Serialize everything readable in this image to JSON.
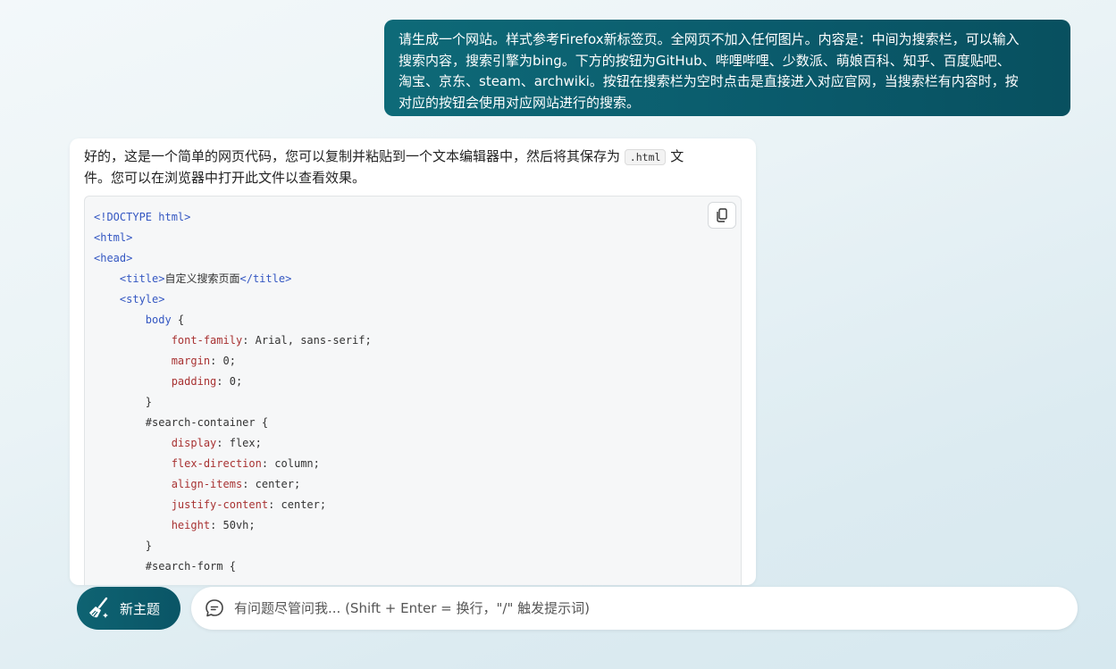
{
  "user_message": {
    "lines": [
      "请生成一个网站。样式参考Firefox新标签页。全网页不加入任何图片。内容是：中间为搜索栏，可以输入",
      "搜索内容，搜索引擎为bing。下方的按钮为GitHub、哔哩哔哩、少数派、萌娘百科、知乎、百度贴吧、",
      "淘宝、京东、steam、archwiki。按钮在搜索栏为空时点击是直接进入对应官网，当搜索栏有内容时，按",
      "对应的按钮会使用对应网站进行的搜索。"
    ]
  },
  "assistant": {
    "intro_part1": "好的，这是一个简单的网页代码，您可以复制并粘贴到一个文本编辑器中，然后将其保存为",
    "intro_code": ".html",
    "intro_part2": "文",
    "intro_line2": "件。您可以在浏览器中打开此文件以查看效果。",
    "code_lines": [
      [
        {
          "t": "<!DOCTYPE html>",
          "c": "tag"
        }
      ],
      [
        {
          "t": "<html>",
          "c": "tag"
        }
      ],
      [
        {
          "t": "<head>",
          "c": "tag"
        }
      ],
      [
        {
          "t": "    ",
          "c": "plain"
        },
        {
          "t": "<title>",
          "c": "tag"
        },
        {
          "t": "自定义搜索页面",
          "c": "plain"
        },
        {
          "t": "</title>",
          "c": "tag"
        }
      ],
      [
        {
          "t": "    ",
          "c": "plain"
        },
        {
          "t": "<style>",
          "c": "tag"
        }
      ],
      [
        {
          "t": "        ",
          "c": "plain"
        },
        {
          "t": "body",
          "c": "tag"
        },
        {
          "t": " {",
          "c": "plain"
        }
      ],
      [
        {
          "t": "            ",
          "c": "plain"
        },
        {
          "t": "font-family",
          "c": "prop"
        },
        {
          "t": ": Arial, sans-serif;",
          "c": "plain"
        }
      ],
      [
        {
          "t": "            ",
          "c": "plain"
        },
        {
          "t": "margin",
          "c": "prop"
        },
        {
          "t": ": 0;",
          "c": "plain"
        }
      ],
      [
        {
          "t": "            ",
          "c": "plain"
        },
        {
          "t": "padding",
          "c": "prop"
        },
        {
          "t": ": 0;",
          "c": "plain"
        }
      ],
      [
        {
          "t": "        }",
          "c": "plain"
        }
      ],
      [
        {
          "t": "        #search-container {",
          "c": "plain"
        }
      ],
      [
        {
          "t": "            ",
          "c": "plain"
        },
        {
          "t": "display",
          "c": "prop"
        },
        {
          "t": ": flex;",
          "c": "plain"
        }
      ],
      [
        {
          "t": "            ",
          "c": "plain"
        },
        {
          "t": "flex-direction",
          "c": "prop"
        },
        {
          "t": ": column;",
          "c": "plain"
        }
      ],
      [
        {
          "t": "            ",
          "c": "plain"
        },
        {
          "t": "align-items",
          "c": "prop"
        },
        {
          "t": ": center;",
          "c": "plain"
        }
      ],
      [
        {
          "t": "            ",
          "c": "plain"
        },
        {
          "t": "justify-content",
          "c": "prop"
        },
        {
          "t": ": center;",
          "c": "plain"
        }
      ],
      [
        {
          "t": "            ",
          "c": "plain"
        },
        {
          "t": "height",
          "c": "prop"
        },
        {
          "t": ": 50vh;",
          "c": "plain"
        }
      ],
      [
        {
          "t": "        }",
          "c": "plain"
        }
      ],
      [
        {
          "t": "        #search-form {",
          "c": "plain"
        }
      ]
    ],
    "copy_icon": "copy-icon"
  },
  "footer": {
    "new_topic_label": "新主题",
    "new_topic_icon": "broom-icon",
    "input_placeholder": "有问题尽管问我... (Shift + Enter = 换行，\"/\" 触发提示词)",
    "input_icon": "chat-bubble-icon"
  },
  "colors": {
    "accent": "#0a5a6b",
    "code_tag": "#3457c2",
    "code_prop": "#a83232"
  }
}
